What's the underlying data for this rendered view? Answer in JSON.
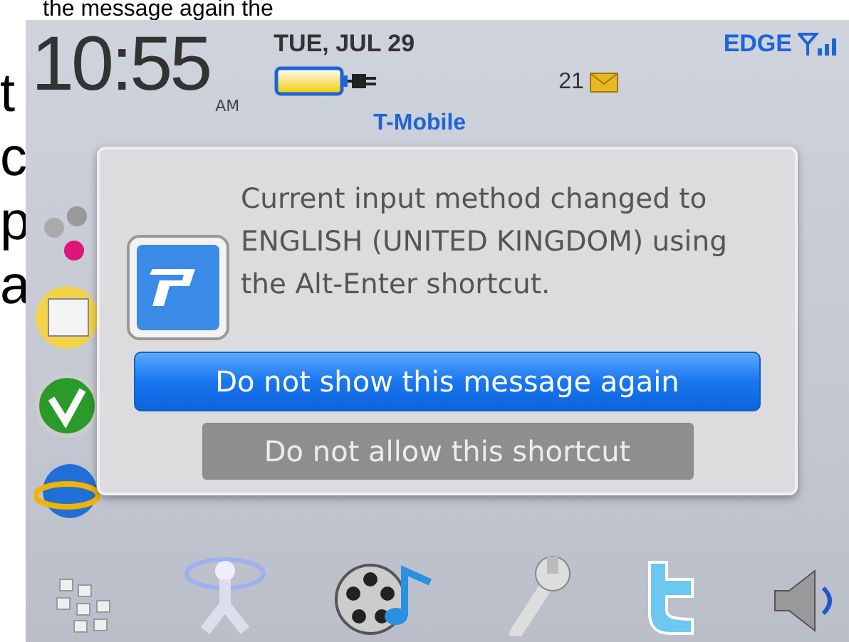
{
  "overlay_text": {
    "top_line": "the message again the",
    "left_letters": [
      "t",
      "c",
      "p",
      "a"
    ]
  },
  "status_bar": {
    "time": "10:55",
    "meridiem": "AM",
    "date": "TUE, JUL 29",
    "battery_charging": true,
    "message_count": "21",
    "network": "EDGE",
    "carrier": "T-Mobile"
  },
  "dialog": {
    "message": "Current input method changed to ENGLISH (UNITED KINGDOM) using the Alt-Enter shortcut.",
    "buttons": [
      {
        "label": "Do not show this message again",
        "selected": true,
        "disabled": false
      },
      {
        "label": "Do not allow this shortcut",
        "selected": false,
        "disabled": true
      }
    ]
  }
}
